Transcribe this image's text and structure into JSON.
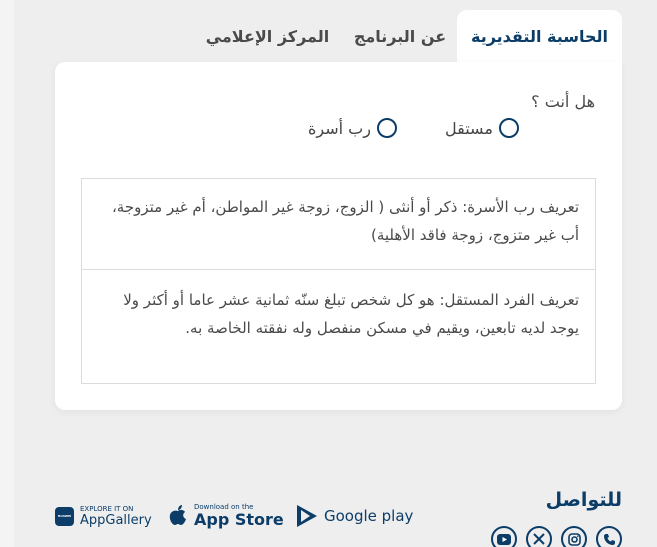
{
  "tabs": [
    {
      "label": "الحاسبة التقديرية",
      "active": true
    },
    {
      "label": "عن البرنامج",
      "active": false
    },
    {
      "label": "المركز الإعلامي",
      "active": false
    }
  ],
  "form": {
    "question": "هل أنت ؟",
    "options": [
      {
        "label": "مستقل",
        "selected": false
      },
      {
        "label": "رب أسرة",
        "selected": false
      }
    ]
  },
  "definitions": [
    "تعريف رب الأسرة: ذكر أو أنثى ( الزوج، زوجة غير المواطن، أم غير متزوجة، أب غير متزوج، زوجة فاقد الأهلية)",
    "تعريف الفرد المستقل: هو كل شخص تبلغ سنّه ثمانية عشر عاما أو أكثر ولا يوجد لديه تابعين، ويقيم في مسكن منفصل وله نفقته الخاصة به."
  ],
  "footer": {
    "contact_title": "للتواصل",
    "social_icons": [
      "phone-icon",
      "instagram-icon",
      "x-icon",
      "youtube-icon"
    ],
    "stores": {
      "google_play": "Google play",
      "app_store_small": "Download on the",
      "app_store_big": "App Store",
      "app_gallery_small": "EXPLORE IT ON",
      "app_gallery_big": "AppGallery",
      "huawei_badge": "HUAWEI"
    }
  },
  "colors": {
    "primary": "#0b3d68",
    "background": "#eeeeee",
    "card": "#ffffff"
  }
}
